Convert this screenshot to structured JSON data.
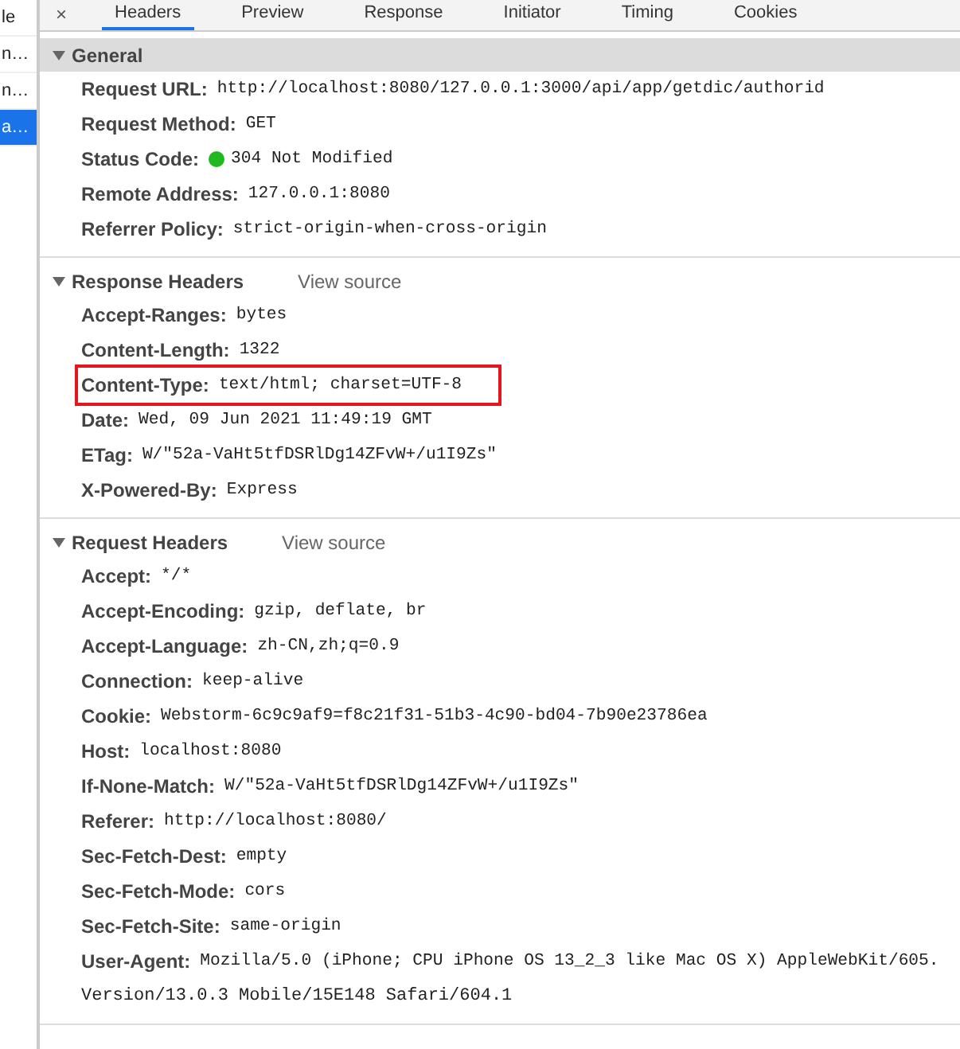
{
  "sidebar": {
    "items": [
      {
        "label": "le",
        "selected": false
      },
      {
        "label": "n…",
        "selected": false
      },
      {
        "label": "n…",
        "selected": false
      },
      {
        "label": "a…",
        "selected": true
      }
    ]
  },
  "close": "×",
  "tabs": [
    {
      "label": "Headers",
      "selected": true
    },
    {
      "label": "Preview",
      "selected": false
    },
    {
      "label": "Response",
      "selected": false
    },
    {
      "label": "Initiator",
      "selected": false
    },
    {
      "label": "Timing",
      "selected": false
    },
    {
      "label": "Cookies",
      "selected": false
    }
  ],
  "sections": [
    {
      "title": "General",
      "expanded": true,
      "rows": [
        {
          "key": "Request URL:",
          "value": "http://localhost:8080/127.0.0.1:3000/api/app/getdic/authorid"
        },
        {
          "key": "Request Method:",
          "value": "GET"
        },
        {
          "key": "Status Code:",
          "value": "304 Not Modified",
          "color": "#1fb81f"
        },
        {
          "key": "Remote Address:",
          "value": "127.0.0.1:8080"
        },
        {
          "key": "Referrer Policy:",
          "value": "strict-origin-when-cross-origin"
        }
      ]
    },
    {
      "title": "Response Headers",
      "link": "View source",
      "expanded": true,
      "rows": [
        {
          "key": "Accept-Ranges:",
          "value": "bytes"
        },
        {
          "key": "Content-Length:",
          "value": "1322"
        },
        {
          "key": "Content-Type:",
          "value": "text/html; charset=UTF-8",
          "highlighted": true
        },
        {
          "key": "Date:",
          "value": "Wed, 09 Jun 2021 11:49:19 GMT"
        },
        {
          "key": "ETag:",
          "value": "W/\"52a-VaHt5tfDSRlDg14ZFvW+/u1I9Zs\""
        },
        {
          "key": "X-Powered-By:",
          "value": "Express"
        }
      ]
    },
    {
      "title": "Request Headers",
      "link": "View source",
      "expanded": true,
      "rows": [
        {
          "key": "Accept:",
          "value": "*/*"
        },
        {
          "key": "Accept-Encoding:",
          "value": "gzip, deflate, br"
        },
        {
          "key": "Accept-Language:",
          "value": "zh-CN,zh;q=0.9"
        },
        {
          "key": "Connection:",
          "value": "keep-alive"
        },
        {
          "key": "Cookie:",
          "value": "Webstorm-6c9c9af9=f8c21f31-51b3-4c90-bd04-7b90e23786ea"
        },
        {
          "key": "Host:",
          "value": "localhost:8080"
        },
        {
          "key": "If-None-Match:",
          "value": "W/\"52a-VaHt5tfDSRlDg14ZFvW+/u1I9Zs\""
        },
        {
          "key": "Referer:",
          "value": "http://localhost:8080/"
        },
        {
          "key": "Sec-Fetch-Dest:",
          "value": "empty"
        },
        {
          "key": "Sec-Fetch-Mode:",
          "value": "cors"
        },
        {
          "key": "Sec-Fetch-Site:",
          "value": "same-origin"
        },
        {
          "key": "User-Agent:",
          "value": "Mozilla/5.0 (iPhone; CPU iPhone OS 13_2_3 like Mac OS X) AppleWebKit/605.",
          "continuation": "Version/13.0.3 Mobile/15E148 Safari/604.1"
        }
      ]
    }
  ]
}
